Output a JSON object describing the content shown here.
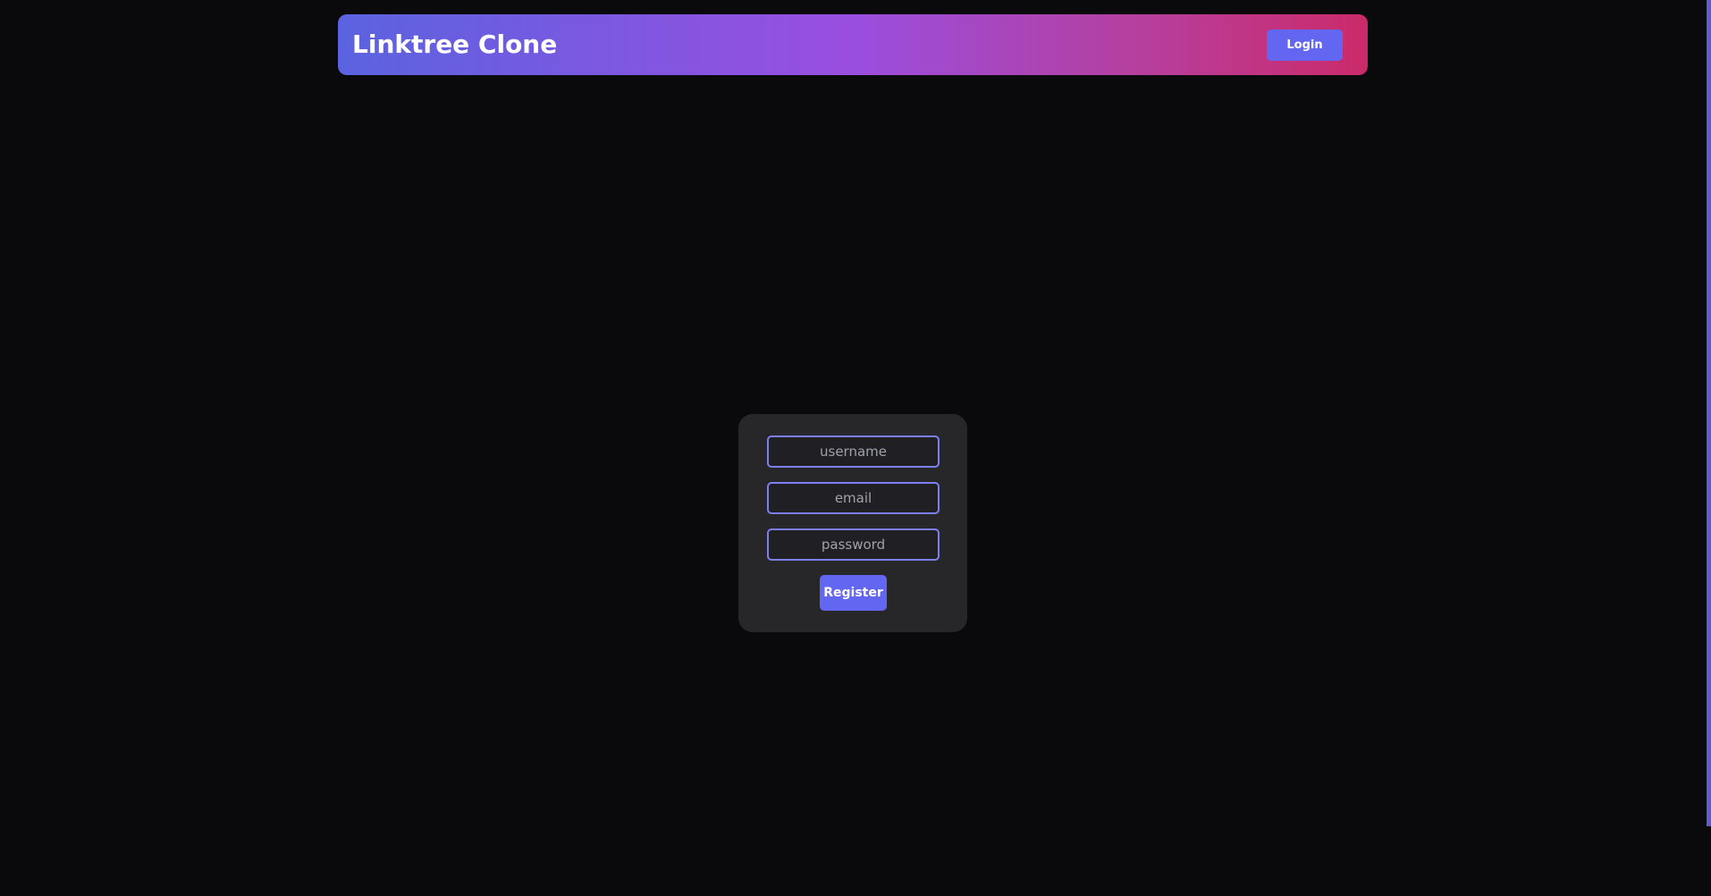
{
  "navbar": {
    "brand": "Linktree Clone",
    "login_label": "Login"
  },
  "register_form": {
    "username_placeholder": "username",
    "email_placeholder": "email",
    "password_placeholder": "password",
    "submit_label": "Register"
  },
  "colors": {
    "background": "#0a0a0c",
    "accent": "#6366f1",
    "card": "#27272a",
    "gradient_start": "#5b63e0",
    "gradient_mid": "#9a4ee0",
    "gradient_end": "#cb2a6a"
  }
}
